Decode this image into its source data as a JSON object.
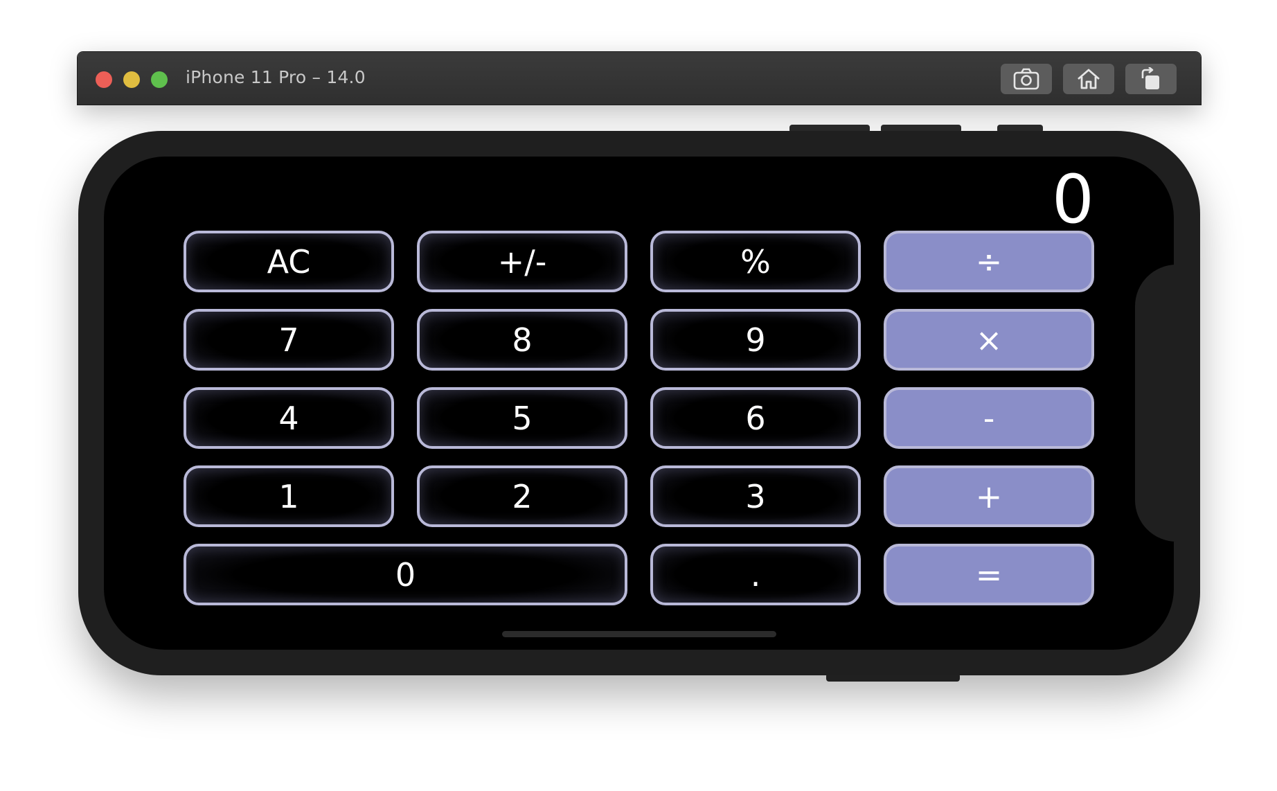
{
  "window": {
    "title": "iPhone 11 Pro – 14.0"
  },
  "toolbar": {
    "screenshot_icon": "camera-icon",
    "home_icon": "home-icon",
    "rotate_icon": "rotate-icon"
  },
  "calculator": {
    "display": "0",
    "keys": {
      "ac": "AC",
      "sign": "+/-",
      "percent": "%",
      "divide": "÷",
      "seven": "7",
      "eight": "8",
      "nine": "9",
      "multiply": "×",
      "four": "4",
      "five": "5",
      "six": "6",
      "subtract": "-",
      "one": "1",
      "two": "2",
      "three": "3",
      "add": "+",
      "zero": "0",
      "decimal": ".",
      "equals": "="
    }
  },
  "colors": {
    "operator_key": "#8a8ec8",
    "key_border": "#b9b9d8",
    "screen_background": "#000000"
  }
}
